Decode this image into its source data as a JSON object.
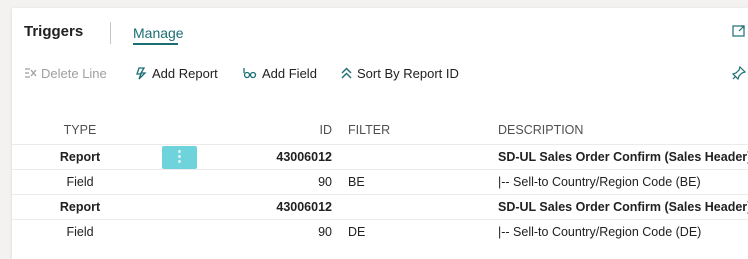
{
  "tabs": {
    "triggers": "Triggers",
    "manage": "Manage"
  },
  "toolbar": {
    "delete_line": "Delete Line",
    "add_report": "Add Report",
    "add_field": "Add Field",
    "sort_by_report_id": "Sort By Report ID"
  },
  "table": {
    "headers": {
      "type": "TYPE",
      "id": "ID",
      "filter": "FILTER",
      "description": "DESCRIPTION"
    },
    "rows": [
      {
        "type": "Report",
        "id": "43006012",
        "filter": "",
        "description": "SD-UL Sales Order Confirm (Sales Header)",
        "bold": true
      },
      {
        "type": "Field",
        "id": "90",
        "filter": "BE",
        "description": "|-- Sell-to Country/Region Code (BE)",
        "bold": false
      },
      {
        "type": "Report",
        "id": "43006012",
        "filter": "",
        "description": "SD-UL Sales Order Confirm (Sales Header)",
        "bold": true
      },
      {
        "type": "Field",
        "id": "90",
        "filter": "DE",
        "description": "|-- Sell-to Country/Region Code (DE)",
        "bold": false
      }
    ],
    "row_menu": "⋮"
  },
  "colors": {
    "accent": "#1a6e74",
    "row_menu_bg": "#6fd3dc",
    "disabled_text": "#a19f9d"
  },
  "icons": {
    "delete_line": "delete-rows-icon",
    "add_report": "lightning-add-icon",
    "add_field": "link-add-icon",
    "sort": "double-chevron-up-icon",
    "expand": "expand-window-icon",
    "pin": "pin-icon"
  }
}
